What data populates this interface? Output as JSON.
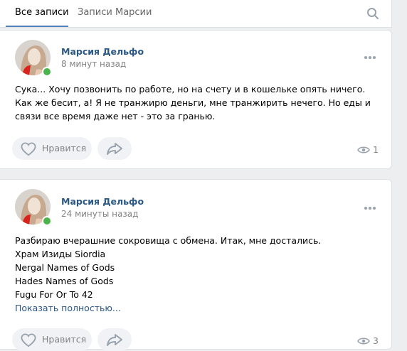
{
  "tabs": [
    {
      "label": "Все записи",
      "active": true
    },
    {
      "label": "Записи Марсии",
      "active": false
    }
  ],
  "posts": [
    {
      "author": "Марсия Дельфо",
      "time": "8 минут назад",
      "lines": [
        "Сука... Хочу позвонить по работе, но на счету и в кошельке опять ничего. Как же бесит, а! Я не транжирю деньги, мне транжирить нечего. Но еды и связи все время даже нет - это за гранью."
      ],
      "like_label": "Нравится",
      "views": "1"
    },
    {
      "author": "Марсия Дельфо",
      "time": "24 минуты назад",
      "lines": [
        "Разбираю вчерашние сокровища с обмена. Итак, мне достались.",
        "Храм Изиды Siordia",
        "Nergal Names of Gods",
        "Hades Names of Gods",
        "Fugu For Or To 42"
      ],
      "show_more": "Показать полностью...",
      "like_label": "Нравится",
      "views": "3"
    }
  ],
  "colors": {
    "accent": "#5181b8",
    "link": "#2a5885",
    "online": "#4bb34b"
  }
}
